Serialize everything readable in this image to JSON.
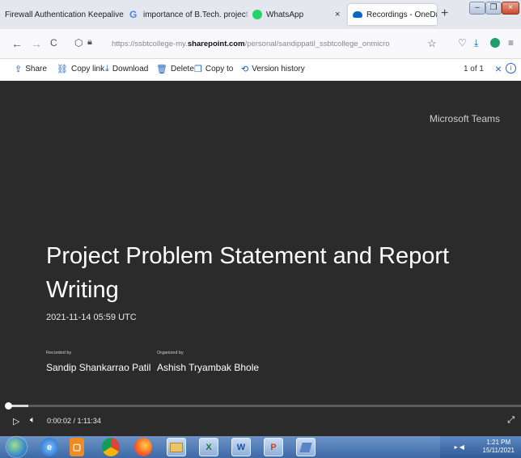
{
  "browser": {
    "tabs": [
      {
        "title": "Firewall Authentication Keepalive",
        "title_fade": "",
        "close": "×",
        "icon": "plain-icon"
      },
      {
        "title": "importance of B.Tech. projec",
        "title_fade": "t",
        "close": "×",
        "icon": "google-icon"
      },
      {
        "title": "WhatsApp",
        "title_fade": "",
        "close": "×",
        "icon": "whatsapp-icon"
      },
      {
        "title": "Recordings - OneDrive",
        "title_fade": "",
        "close": "×",
        "icon": "onedrive-icon",
        "active": true
      }
    ],
    "new_tab": "+",
    "url": {
      "prefix": "https://ssbtcollege-my.",
      "domain": "sharepoint.com",
      "suffix": "/personal/sandippatil_ssbtcollege_onmicro"
    },
    "nav": {
      "back": "←",
      "forward": "→",
      "reload": "C",
      "star": "☆"
    }
  },
  "toolbar": {
    "share": "Share",
    "copy_link": "Copy link",
    "download": "Download",
    "delete": "Delete",
    "copy_to": "Copy to",
    "version_history": "Version history",
    "pager": "1 of 1",
    "close": "×",
    "info": "i"
  },
  "video": {
    "brand": "Microsoft Teams",
    "title": "Project Problem Statement and Report Writing",
    "date": "2021-11-14 05:59 UTC",
    "recorded_label": "Recorded by",
    "recorded_name": "Sandip Shankarrao Patil",
    "organized_label": "Organized by",
    "organized_name": "Ashish Tryambak Bhole",
    "time_text": "0:00:02 / 1:11:34",
    "progress_fraction": 0.04
  },
  "taskbar": {
    "apps": [
      "ie-icon",
      "media-player-icon",
      "chrome-icon",
      "firefox-icon",
      "explorer-icon",
      "excel-icon",
      "word-icon",
      "powerpoint-icon",
      "app-icon"
    ],
    "word_glyph": "W",
    "ppt_glyph": "P",
    "excel_glyph": "X",
    "time": "1:21 PM",
    "date": "15/11/2021"
  },
  "colors": {
    "accent": "#1a5fb4",
    "video_bg": "#2b2b2b",
    "taskbar": "#3d6aa6"
  }
}
